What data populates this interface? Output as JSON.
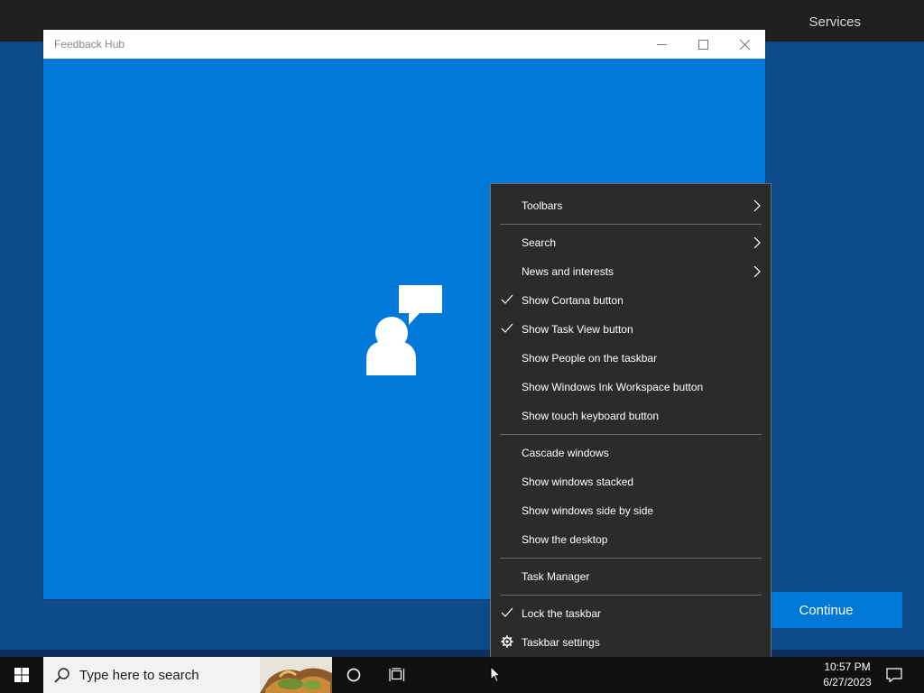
{
  "background": {
    "top_title": "Services",
    "continue_label": "Continue"
  },
  "window": {
    "title": "Feedback Hub",
    "controls": [
      "minimize-icon",
      "maximize-icon",
      "close-icon"
    ],
    "logo_icon": "feedback-person-icon"
  },
  "context_menu": {
    "items": [
      {
        "label": "Toolbars",
        "checked": false,
        "submenu": true
      },
      {
        "label": "Search",
        "checked": false,
        "submenu": true
      },
      {
        "label": "News and interests",
        "checked": false,
        "submenu": true
      },
      {
        "label": "Show Cortana button",
        "checked": true,
        "submenu": false
      },
      {
        "label": "Show Task View button",
        "checked": true,
        "submenu": false
      },
      {
        "label": "Show People on the taskbar",
        "checked": false,
        "submenu": false
      },
      {
        "label": "Show Windows Ink Workspace button",
        "checked": false,
        "submenu": false
      },
      {
        "label": "Show touch keyboard button",
        "checked": false,
        "submenu": false
      },
      {
        "label": "Cascade windows",
        "checked": false,
        "submenu": false
      },
      {
        "label": "Show windows stacked",
        "checked": false,
        "submenu": false
      },
      {
        "label": "Show windows side by side",
        "checked": false,
        "submenu": false
      },
      {
        "label": "Show the desktop",
        "checked": false,
        "submenu": false
      },
      {
        "label": "Task Manager",
        "checked": false,
        "submenu": false
      },
      {
        "label": "Lock the taskbar",
        "checked": true,
        "submenu": false
      },
      {
        "label": "Taskbar settings",
        "checked": false,
        "submenu": false,
        "icon": "gear-icon"
      }
    ]
  },
  "taskbar": {
    "search_placeholder": "Type here to search",
    "time": "10:57 PM",
    "date": "6/27/2023",
    "icons": [
      "windows-start-icon",
      "search-icon",
      "cortana-icon",
      "task-view-icon",
      "notification-icon"
    ]
  },
  "colors": {
    "accent": "#0078d7",
    "menu_bg": "#2b2b2b",
    "taskbar_bg": "#101010"
  }
}
